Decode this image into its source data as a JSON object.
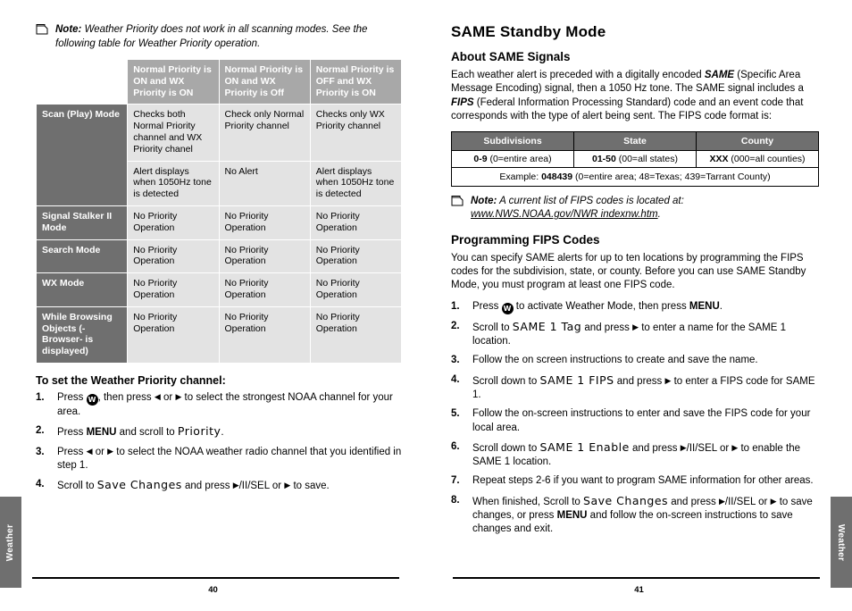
{
  "left_page": {
    "folio": "40",
    "side_tab": "Weather",
    "note": {
      "label": "Note:",
      "text": " Weather Priority does not work in all scanning modes. See the following table for Weather Priority operation."
    },
    "table": {
      "headers": [
        "",
        "Normal Priority is ON and WX Priority is ON",
        "Normal Priority is ON and WX Priority is Off",
        "Normal Priority is OFF and WX Priority is ON"
      ],
      "rows": [
        {
          "label": "Scan (Play) Mode",
          "cells_top": [
            "Checks both Normal Priority channel and WX Priority chanel",
            "Check only Normal Priority channel",
            "Checks only WX Priority channel"
          ],
          "cells_bottom": [
            "Alert displays when 1050Hz tone is detected",
            "No Alert",
            "Alert displays when 1050Hz tone is detected"
          ]
        },
        {
          "label": "Signal Stalker II Mode",
          "cells": [
            "No Priority Operation",
            "No Priority Operation",
            "No Priority Operation"
          ]
        },
        {
          "label": "Search Mode",
          "cells": [
            "No Priority Operation",
            "No Priority Operation",
            "No Priority Operation"
          ]
        },
        {
          "label": "WX Mode",
          "cells": [
            "No Priority Operation",
            "No Priority Operation",
            "No Priority Operation"
          ]
        },
        {
          "label": "While Browsing Objects (-Browser- is displayed)",
          "cells": [
            "No Priority Operation",
            "No Priority Operation",
            "No Priority Operation"
          ]
        }
      ]
    },
    "steps_heading": "To set the Weather Priority channel:",
    "steps": [
      {
        "n": "1.",
        "html": "Press <span class=\"btn-circle\">W</span>, then press <span class=\"tri\">&#9664;</span> or <span class=\"tri\">&#9654;</span> to select the strongest NOAA channel for your area."
      },
      {
        "n": "2.",
        "html": "Press <b>MENU</b> and scroll to <span class=\"lcd-big\">Priority</span>."
      },
      {
        "n": "3.",
        "html": "Press <span class=\"tri\">&#9664;</span> or <span class=\"tri\">&#9654;</span> to select the NOAA weather radio channel that you identified in step 1."
      },
      {
        "n": "4.",
        "html": "Scroll to <span class=\"lcd-big\">Save Changes</span> and press <span class=\"tri\">&#9654;</span>/II/SEL or <span class=\"tri\">&#9654;</span> to save."
      }
    ]
  },
  "right_page": {
    "folio": "41",
    "side_tab": "Weather",
    "title": "SAME Standby Mode",
    "section1_heading": "About SAME Signals",
    "section1_paragraphs": [
      "Each weather alert is preceded with a digitally encoded SAME (Specific Area Message Encoding) signal, then a 1050 Hz tone. The SAME signal includes a FIPS (Federal Information Processing Standard) code and an event code that corresponds with the type of alert being sent. The FIPS code format is:"
    ],
    "fips_table": {
      "headers": [
        "Subdivisions",
        "State",
        "County"
      ],
      "values": [
        "0-9 (0=entire area)",
        "01-50 (00=all states)",
        "XXX (000=all counties)"
      ],
      "example": "Example: 048439 (0=entire area; 48=Texas; 439=Tarrant County)"
    },
    "note": {
      "label": "Note:",
      "text": " A current list of FIPS codes is located at:",
      "link": "www.NWS.NOAA.gov/NWR indexnw.htm",
      "after": "."
    },
    "section2_heading": "Programming FIPS Codes",
    "section2_paragraph": "You can specify SAME alerts for up to ten locations by programming the FIPS codes for the subdivision, state, or county. Before you can use SAME Standby Mode, you must program at least one FIPS code.",
    "steps": [
      {
        "n": "1.",
        "html": "Press <span class=\"btn-circle\">W</span> to activate Weather Mode, then press <b>MENU</b>."
      },
      {
        "n": "2.",
        "html": "Scroll to <span class=\"lcd-big\">SAME 1 Tag</span> and press <span class=\"tri\">&#9654;</span> to enter a name for the SAME 1 location."
      },
      {
        "n": "3.",
        "html": "Follow the on screen instructions to create and save the name."
      },
      {
        "n": "4.",
        "html": "Scroll down to <span class=\"lcd-big\">SAME 1 FIPS</span> and press <span class=\"tri\">&#9654;</span> to enter a FIPS code for SAME 1."
      },
      {
        "n": "5.",
        "html": "Follow the on-screen instructions to enter and save the FIPS code for your local area."
      },
      {
        "n": "6.",
        "html": "Scroll down to <span class=\"lcd-big\">SAME 1 Enable</span> and press <span class=\"tri\">&#9654;</span>/II/SEL or <span class=\"tri\">&#9654;</span> to enable the SAME 1 location."
      },
      {
        "n": "7.",
        "html": "Repeat steps 2-6 if you want to program SAME information for other areas."
      },
      {
        "n": "8.",
        "html": "When finished, Scroll to <span class=\"lcd-big\">Save Changes</span> and press <span class=\"tri\">&#9654;</span>/II/SEL or <span class=\"tri\">&#9654;</span> to save changes, or press <b>MENU</b> and follow the on-screen instructions to save changes and exit."
      }
    ]
  }
}
